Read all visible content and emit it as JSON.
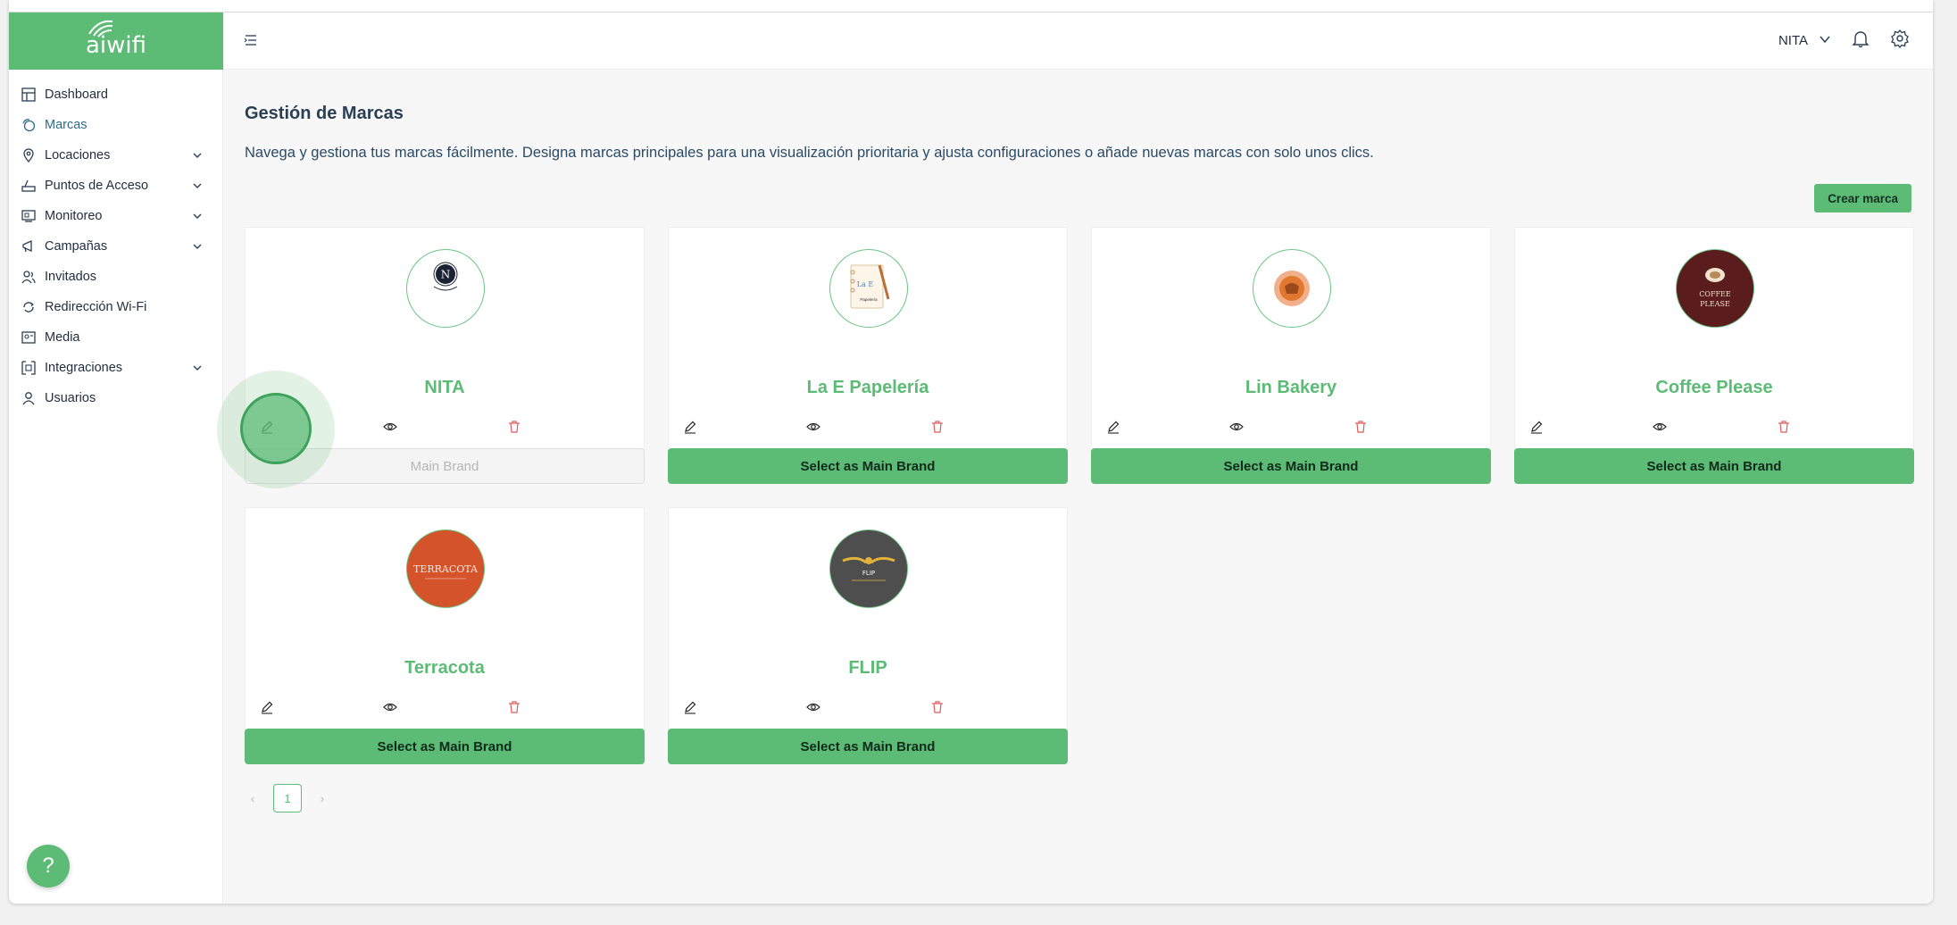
{
  "app": {
    "logo_text": "aiwifi"
  },
  "sidebar": {
    "items": [
      {
        "label": "Dashboard",
        "icon": "dashboard-icon"
      },
      {
        "label": "Marcas",
        "icon": "brands-icon"
      },
      {
        "label": "Locaciones",
        "icon": "location-pin-icon"
      },
      {
        "label": "Puntos de Acceso",
        "icon": "router-icon"
      },
      {
        "label": "Monitoreo",
        "icon": "monitor-icon"
      },
      {
        "label": "Campañas",
        "icon": "megaphone-icon"
      },
      {
        "label": "Invitados",
        "icon": "users-icon"
      },
      {
        "label": "Redirección Wi-Fi",
        "icon": "redirect-icon"
      },
      {
        "label": "Media",
        "icon": "media-icon"
      },
      {
        "label": "Integraciones",
        "icon": "integrations-icon"
      },
      {
        "label": "Usuarios",
        "icon": "user-icon"
      }
    ],
    "help_label": "?"
  },
  "header": {
    "user_name": "NITA"
  },
  "page": {
    "title": "Gestión de Marcas",
    "description": "Navega y gestiona tus marcas fácilmente. Designa marcas principales para una visualización prioritaria y ajusta configuraciones o añade nuevas marcas con solo unos clics.",
    "create_button": "Crear marca"
  },
  "brands": [
    {
      "name": "NITA",
      "button": "Main Brand",
      "is_main": true
    },
    {
      "name": "La E Papelería",
      "button": "Select as Main Brand",
      "is_main": false
    },
    {
      "name": "Lin Bakery",
      "button": "Select as Main Brand",
      "is_main": false
    },
    {
      "name": "Coffee Please",
      "button": "Select as Main Brand",
      "is_main": false
    },
    {
      "name": "Terracota",
      "button": "Select as Main Brand",
      "is_main": false
    },
    {
      "name": "FLIP",
      "button": "Select as Main Brand",
      "is_main": false
    }
  ],
  "logos": {
    "nita_letter": "N",
    "lae_text": "La E",
    "lae_sub": "Papelería",
    "coffee_line1": "COFFEE",
    "coffee_line2": "PLEASE",
    "terracota_text": "TERRACOTA",
    "flip_text": "FLIP"
  },
  "pagination": {
    "prev": "‹",
    "current": "1",
    "next": "›"
  },
  "colors": {
    "accent": "#5cbb75",
    "delete": "#e05a5a"
  }
}
